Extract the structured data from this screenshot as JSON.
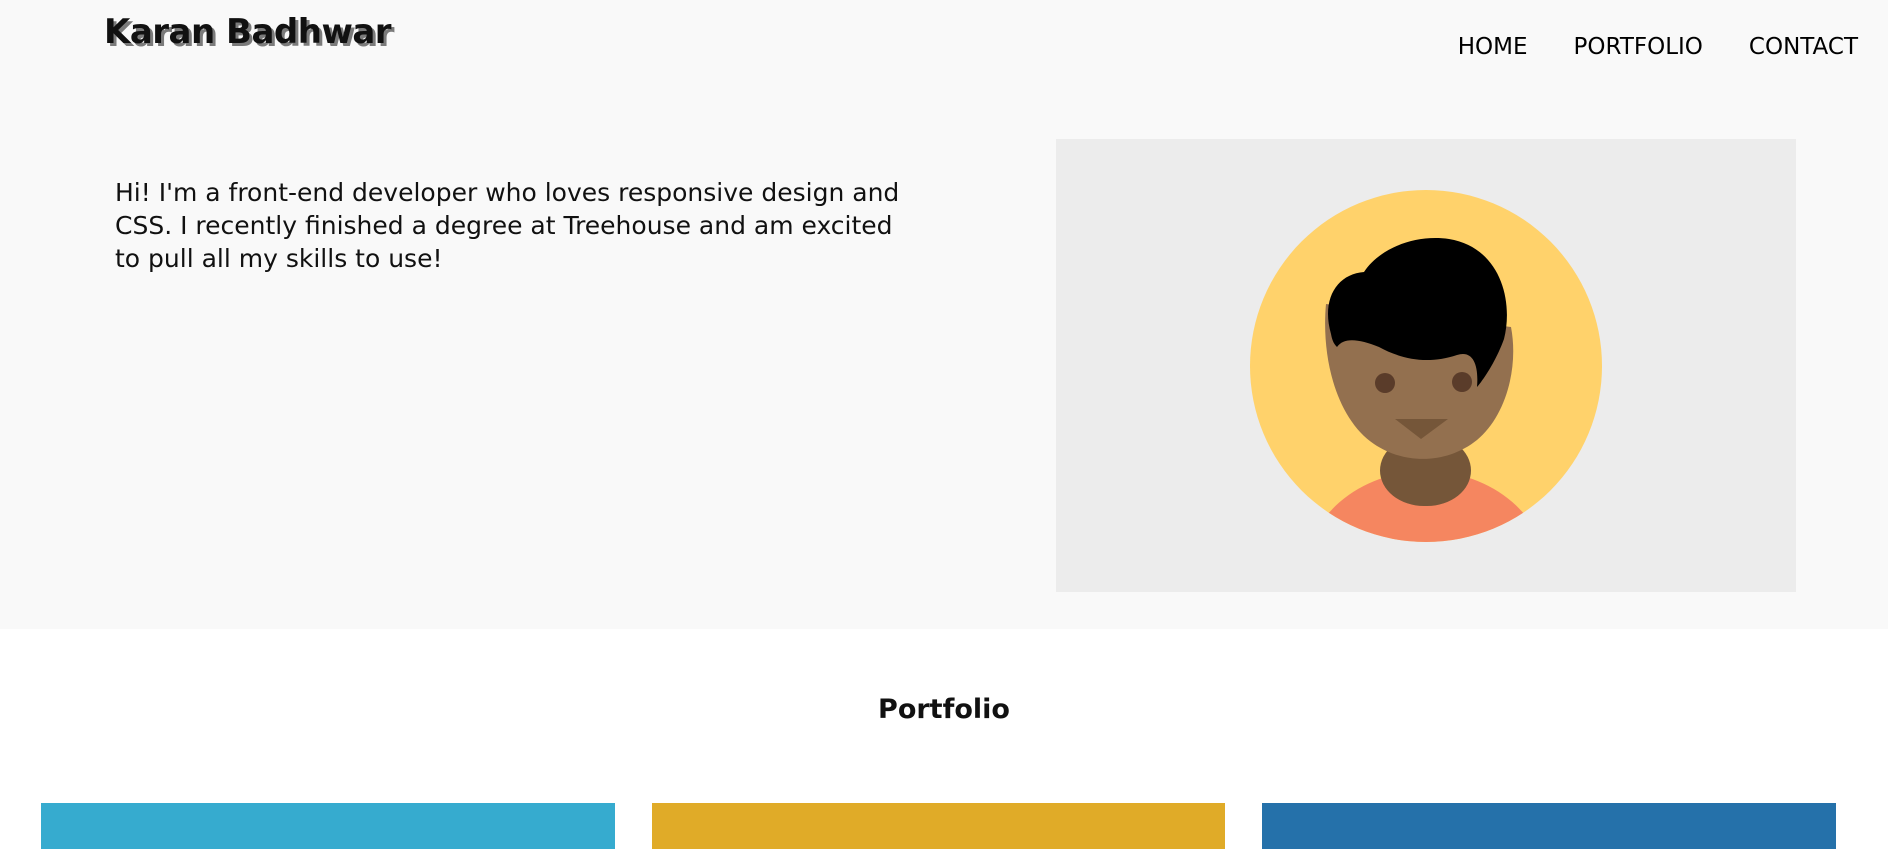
{
  "header": {
    "brand": "Karan Badhwar"
  },
  "nav": {
    "items": [
      {
        "label": "HOME"
      },
      {
        "label": "PORTFOLIO"
      },
      {
        "label": "CONTACT"
      }
    ]
  },
  "intro": {
    "text": "Hi! I'm a front-end developer who loves responsive design and CSS. I recently finished a degree at Treehouse and am excited to pull all my skills to use!"
  },
  "avatar": {
    "icon": "user-avatar-icon",
    "colors": {
      "background": "#ffd26b",
      "skin": "#93704f",
      "hair": "#000000",
      "neck": "#755639",
      "shirt": "#f58660"
    }
  },
  "portfolio": {
    "title": "Portfolio",
    "cards": [
      {
        "color": "#36abcf"
      },
      {
        "color": "#e0ab28"
      },
      {
        "color": "#2571aa"
      }
    ]
  },
  "colors": {
    "hero_background": "#f9f9f9",
    "avatar_panel": "#ececec"
  }
}
